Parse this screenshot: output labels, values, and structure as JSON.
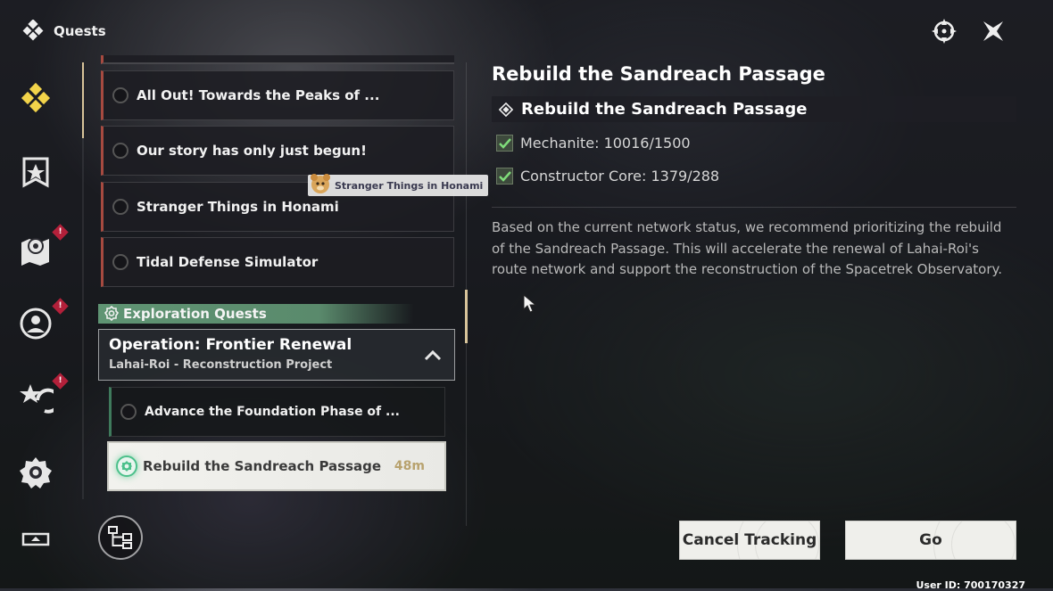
{
  "header": {
    "title": "Quests"
  },
  "top_icons": [
    "crosshair-icon",
    "close-icon"
  ],
  "nav": {
    "items": [
      {
        "name": "nav-quests-icon",
        "badge": null
      },
      {
        "name": "nav-banner-icon",
        "badge": null
      },
      {
        "name": "nav-map-icon",
        "badge": "!"
      },
      {
        "name": "nav-character-icon",
        "badge": "!"
      },
      {
        "name": "nav-star-icon",
        "badge": "!"
      },
      {
        "name": "nav-settings-icon",
        "badge": null
      },
      {
        "name": "nav-display-icon",
        "badge": null
      }
    ]
  },
  "quest_list": {
    "items": [
      {
        "label": "All Out! Towards the Peaks of ..."
      },
      {
        "label": "Our story has only just begun!"
      },
      {
        "label": "Stranger Things in Honami"
      },
      {
        "label": "Tidal Defense Simulator"
      }
    ],
    "tooltip": "Stranger Things in Honami",
    "section_header": "Exploration Quests",
    "chain": {
      "title": "Operation: Frontier Renewal",
      "subtitle": "Lahai-Roi - Reconstruction Project"
    },
    "subquests": [
      {
        "label": "Advance the Foundation Phase of ..."
      },
      {
        "label": "Rebuild the Sandreach Passage",
        "time": "48m"
      }
    ]
  },
  "detail": {
    "title": "Rebuild the Sandreach Passage",
    "objective_header": "Rebuild the Sandreach Passage",
    "objectives": [
      {
        "text": "Mechanite: 10016/1500",
        "done": true
      },
      {
        "text": "Constructor Core: 1379/288",
        "done": true
      }
    ],
    "description": "Based on the current network status, we recommend prioritizing the rebuild of the Sandreach Passage. This will accelerate the renewal of Lahai-Roi's route network and support the reconstruction of the Spacetrek Observatory."
  },
  "buttons": {
    "cancel": "Cancel Tracking",
    "go": "Go"
  },
  "footer": {
    "user_id": "User ID: 700170327"
  },
  "colors": {
    "accent_gold": "#d8c49a",
    "exploration_green": "#5f9473",
    "quest_red": "#a64a40",
    "time_gold": "#b8a26e"
  }
}
